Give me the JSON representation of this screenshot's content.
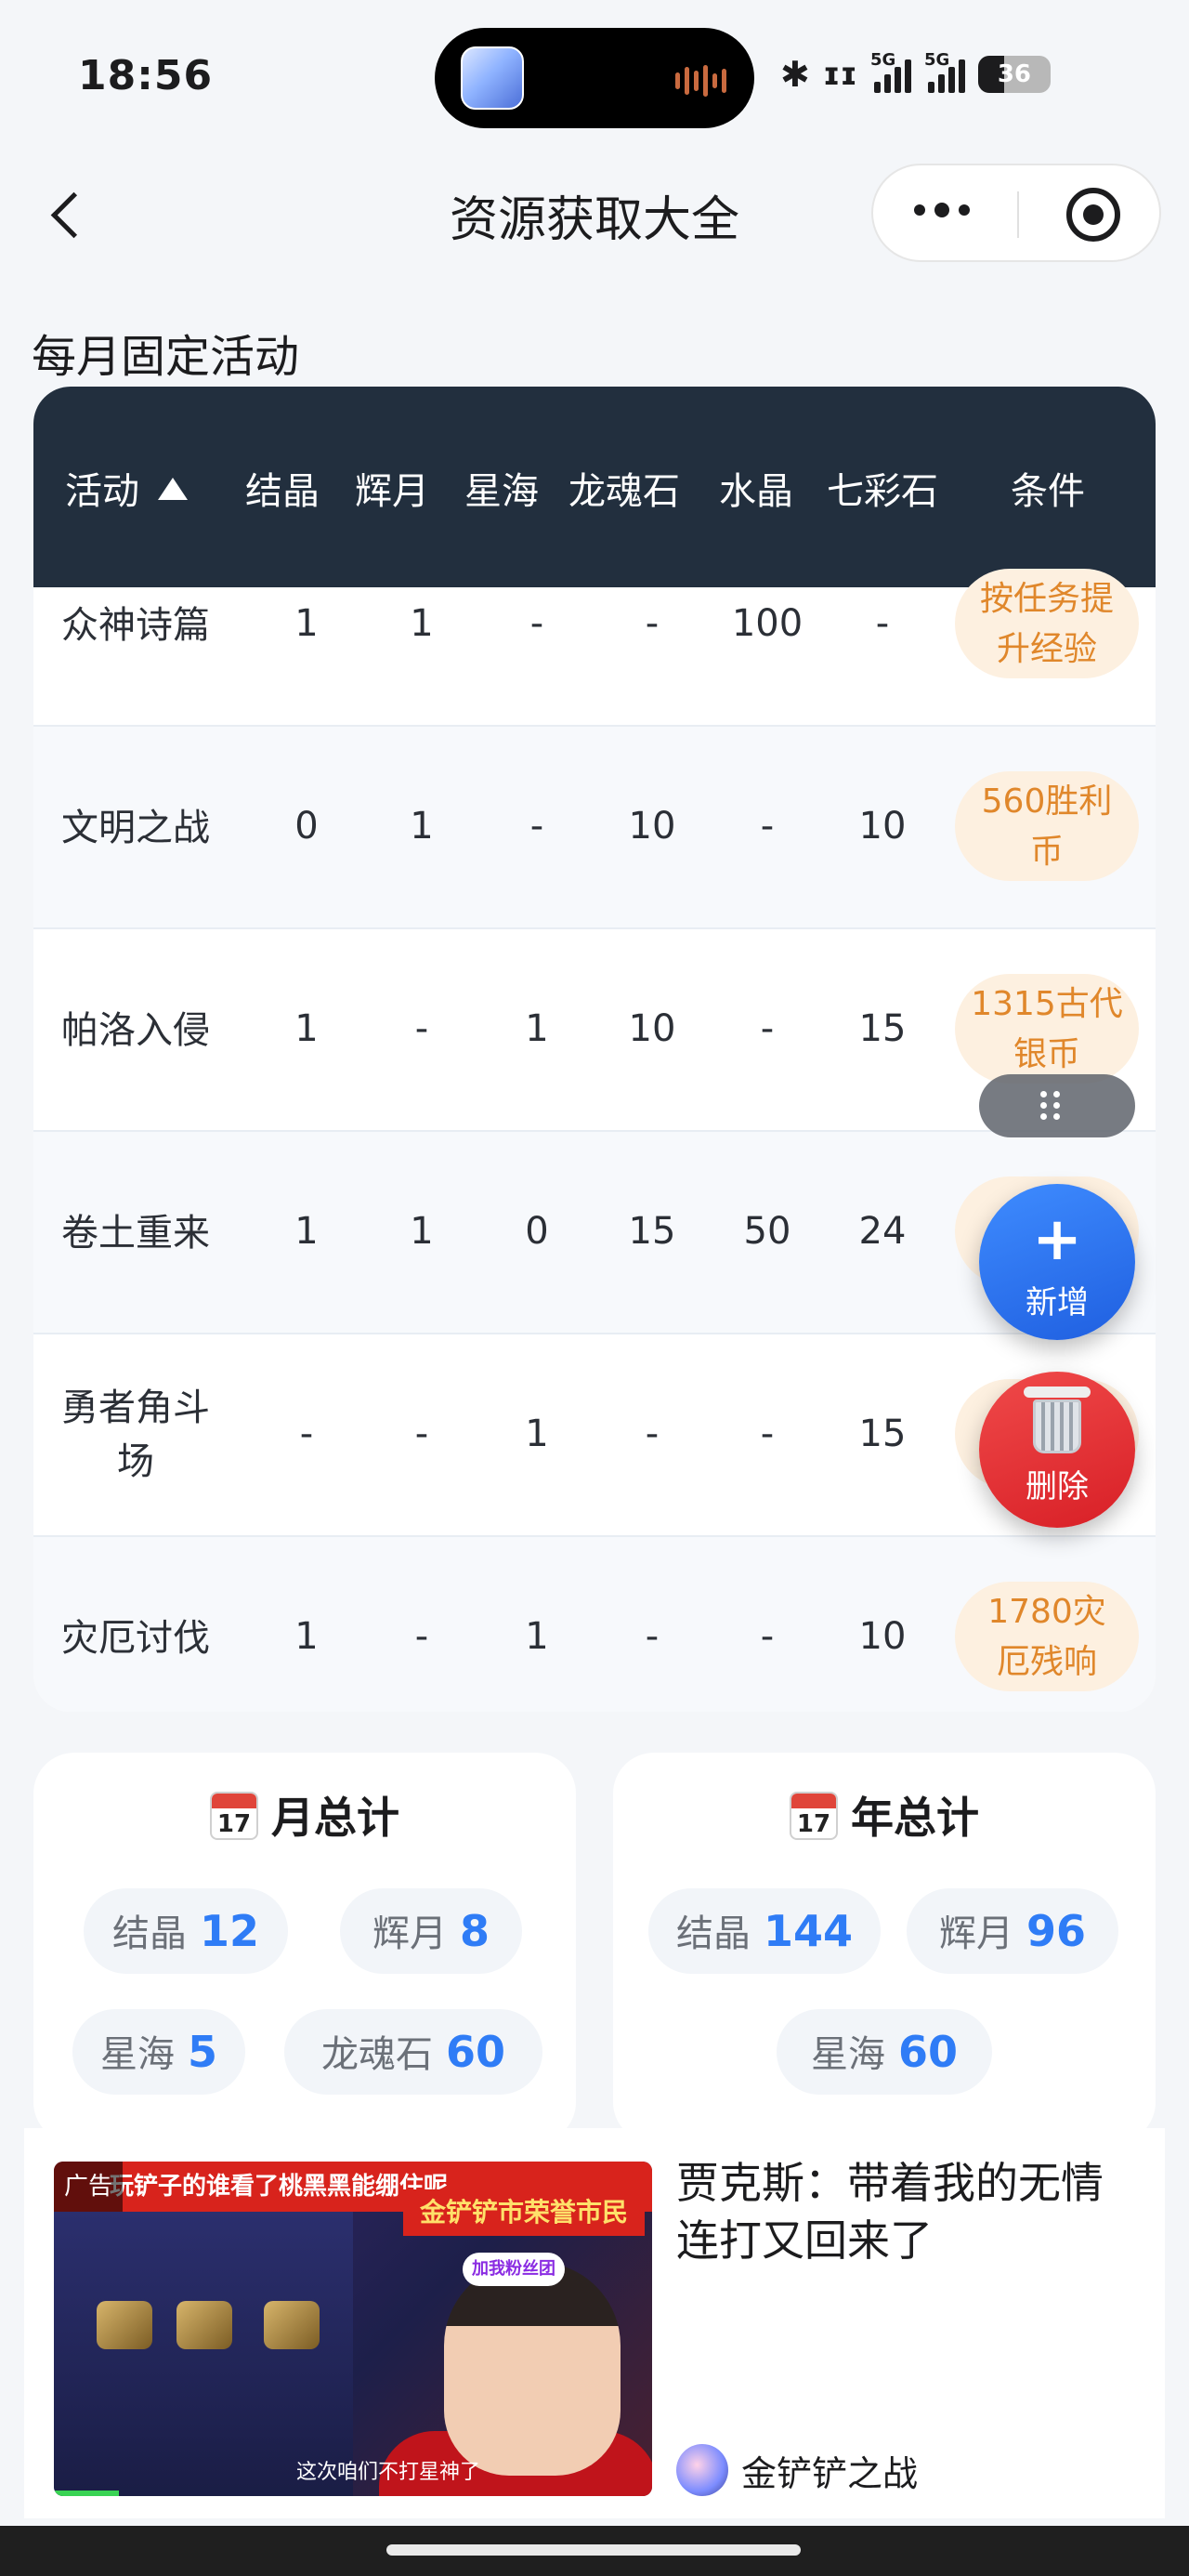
{
  "status_bar": {
    "time": "18:56",
    "battery": "36",
    "net1": "5G",
    "net2": "5G"
  },
  "nav": {
    "title": "资源获取大全"
  },
  "section": {
    "title": "每月固定活动"
  },
  "table": {
    "headers": [
      "活动",
      "结晶",
      "辉月",
      "星海",
      "龙魂石",
      "水晶",
      "七彩石",
      "条件"
    ],
    "rows": [
      {
        "name": "众神诗篇",
        "name_l1": "众神诗篇",
        "name_l2": "",
        "vals": [
          "1",
          "1",
          "-",
          "-",
          "100",
          "-"
        ],
        "cond_l1": "按任务提",
        "cond_l2": "升经验"
      },
      {
        "name": "文明之战",
        "name_l1": "文明之战",
        "name_l2": "",
        "vals": [
          "0",
          "1",
          "-",
          "10",
          "-",
          "10"
        ],
        "cond_l1": "560胜利",
        "cond_l2": "币"
      },
      {
        "name": "帕洛入侵",
        "name_l1": "帕洛入侵",
        "name_l2": "",
        "vals": [
          "1",
          "-",
          "1",
          "10",
          "-",
          "15"
        ],
        "cond_l1": "1315古代",
        "cond_l2": "银币"
      },
      {
        "name": "卷土重来",
        "name_l1": "卷土重来",
        "name_l2": "",
        "vals": [
          "1",
          "1",
          "0",
          "15",
          "50",
          "24"
        ],
        "cond_l1": "",
        "cond_l2": ""
      },
      {
        "name": "勇者角斗场",
        "name_l1": "勇者角斗",
        "name_l2": "场",
        "vals": [
          "-",
          "-",
          "1",
          "-",
          "-",
          "15"
        ],
        "cond_l1": "",
        "cond_l2": ""
      },
      {
        "name": "灾厄讨伐",
        "name_l1": "灾厄讨伐",
        "name_l2": "",
        "vals": [
          "1",
          "-",
          "1",
          "-",
          "-",
          "10"
        ],
        "cond_l1": "1780灾",
        "cond_l2": "厄残响"
      }
    ]
  },
  "fab": {
    "add_label": "新增",
    "add_symbol": "+",
    "delete_label": "删除"
  },
  "month_total": {
    "title": "月总计",
    "cal_day": "17",
    "items": [
      {
        "label": "结晶",
        "value": "12"
      },
      {
        "label": "辉月",
        "value": "8"
      },
      {
        "label": "星海",
        "value": "5"
      },
      {
        "label": "龙魂石",
        "value": "60"
      }
    ]
  },
  "year_total": {
    "title": "年总计",
    "cal_day": "17",
    "items": [
      {
        "label": "结晶",
        "value": "144"
      },
      {
        "label": "辉月",
        "value": "96"
      },
      {
        "label": "星海",
        "value": "60"
      }
    ]
  },
  "ad": {
    "tag": "广告",
    "banner": "玩铲子的谁看了桃黑黑能绷住呢",
    "sign": "金铲铲市荣誉市民",
    "badge": "加我粉丝团",
    "caption": "这次咱们不打星神了",
    "title": "贾克斯：带着我的无情连打又回来了",
    "source": "金铲铲之战"
  },
  "colors": {
    "header_bg": "#222f3e",
    "accent_blue": "#2f7cf6",
    "condition_text": "#e0872b",
    "fab_add": "#2f6ff0",
    "fab_delete": "#e02a2e"
  }
}
